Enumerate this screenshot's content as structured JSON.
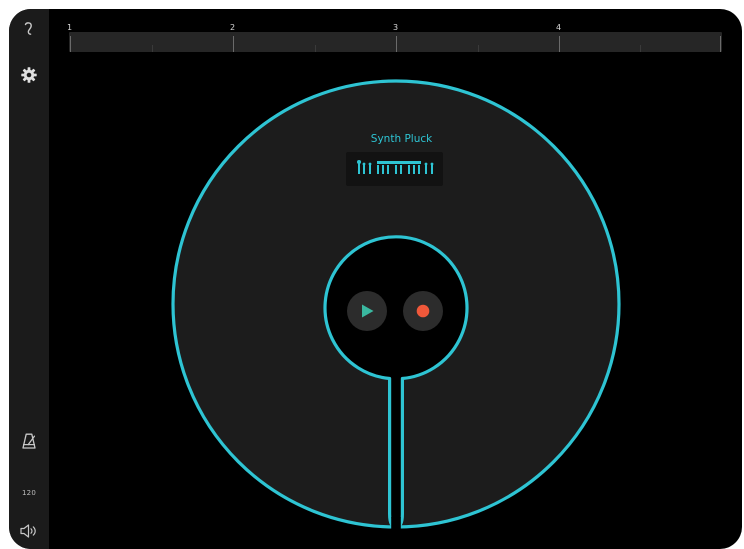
{
  "app": {
    "sidebar": {
      "items": [
        {
          "name": "back",
          "icon": "back-curl-icon"
        },
        {
          "name": "settings",
          "icon": "gear-icon"
        },
        {
          "name": "metronome",
          "icon": "metronome-icon"
        },
        {
          "name": "tempo",
          "label": "120"
        },
        {
          "name": "volume",
          "icon": "speaker-icon"
        }
      ]
    },
    "timeline": {
      "bar_numbers": [
        "1",
        "2",
        "3",
        "4"
      ]
    },
    "instrument": {
      "name": "Synth Pluck",
      "icon": "keyboard-icon"
    },
    "transport": {
      "play_icon": "play-icon",
      "record_icon": "record-icon"
    },
    "colors": {
      "accent": "#2ec4d3",
      "play": "#3ab8a0",
      "record": "#f0583a",
      "ring_fill": "#1c1c1c",
      "background": "#000000",
      "sidebar": "#1b1b1b"
    }
  }
}
